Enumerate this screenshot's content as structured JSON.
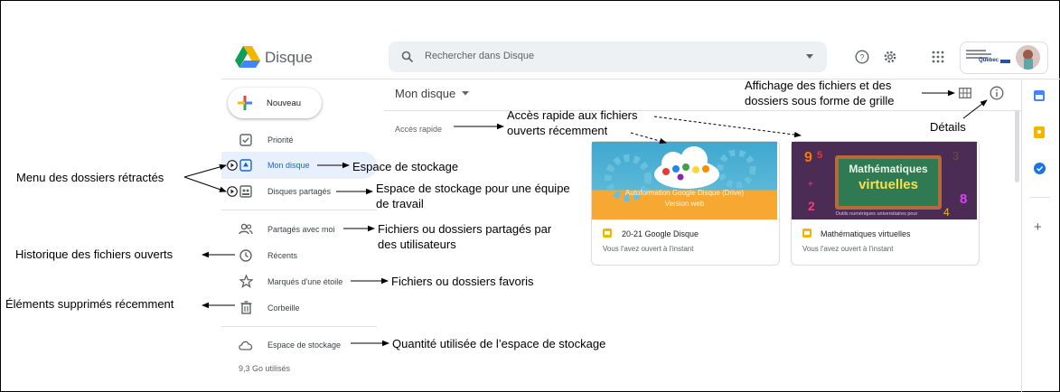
{
  "app": {
    "name": "Disque"
  },
  "search": {
    "placeholder": "Rechercher dans Disque"
  },
  "header": {
    "account_org": "Québec"
  },
  "sidebar": {
    "new_label": "Nouveau",
    "items": [
      {
        "label": "Priorité",
        "icon": "priority-check-icon"
      },
      {
        "label": "Mon disque",
        "icon": "my-drive-icon",
        "active": true
      },
      {
        "label": "Disques partagés",
        "icon": "shared-drives-icon"
      },
      {
        "label": "Partagés avec moi",
        "icon": "people-icon"
      },
      {
        "label": "Récents",
        "icon": "clock-icon"
      },
      {
        "label": "Marqués d'une étoile",
        "icon": "star-icon"
      },
      {
        "label": "Corbeille",
        "icon": "trash-icon"
      },
      {
        "label": "Espace de stockage",
        "icon": "cloud-icon"
      }
    ],
    "storage_used": "9,3 Go utilisés"
  },
  "main": {
    "title": "Mon disque",
    "quick_access_label": "Accès rapide",
    "files": [
      {
        "thumb_text_1": "Autoformation Google Disque (Drive)",
        "thumb_text_2": "Version web",
        "name": "20-21 Google Disque",
        "subtitle": "Vous l'avez ouvert à l'instant"
      },
      {
        "thumb_text_1": "Mathématiques",
        "thumb_text_2": "virtuelles",
        "thumb_caption": "Outils numériques universitaires pour",
        "name": "Mathématiques virtuelles",
        "subtitle": "Vous l'avez ouvert à l'instant"
      }
    ]
  },
  "annotations": {
    "menu_dossiers": "Menu des dossiers rétractés",
    "historique": "Historique des fichiers ouverts",
    "elements_supprimes": "Éléments supprimés récemment",
    "espace_stockage": "Espace de stockage",
    "espace_equipe_1": "Espace de stockage pour une équipe",
    "espace_equipe_2": "de travail",
    "partages_1": "Fichiers ou dossiers partagés par",
    "partages_2": "des utilisateurs",
    "favoris": "Fichiers ou dossiers favoris",
    "quantite": "Quantité utilisée de l’espace de stockage",
    "acces_rapide_1": "Accès rapide aux fichiers",
    "acces_rapide_2": "ouverts récemment",
    "affichage_1": "Affichage des fichiers et des",
    "affichage_2": "dossiers sous forme de grille",
    "details": "Détails"
  },
  "colors": {
    "drive_blue": "#4285f4",
    "drive_green": "#0f9d58",
    "drive_yellow": "#f4b400",
    "drive_red": "#db4437",
    "active_bg": "#e8f0fe",
    "active_text": "#1967d2"
  }
}
